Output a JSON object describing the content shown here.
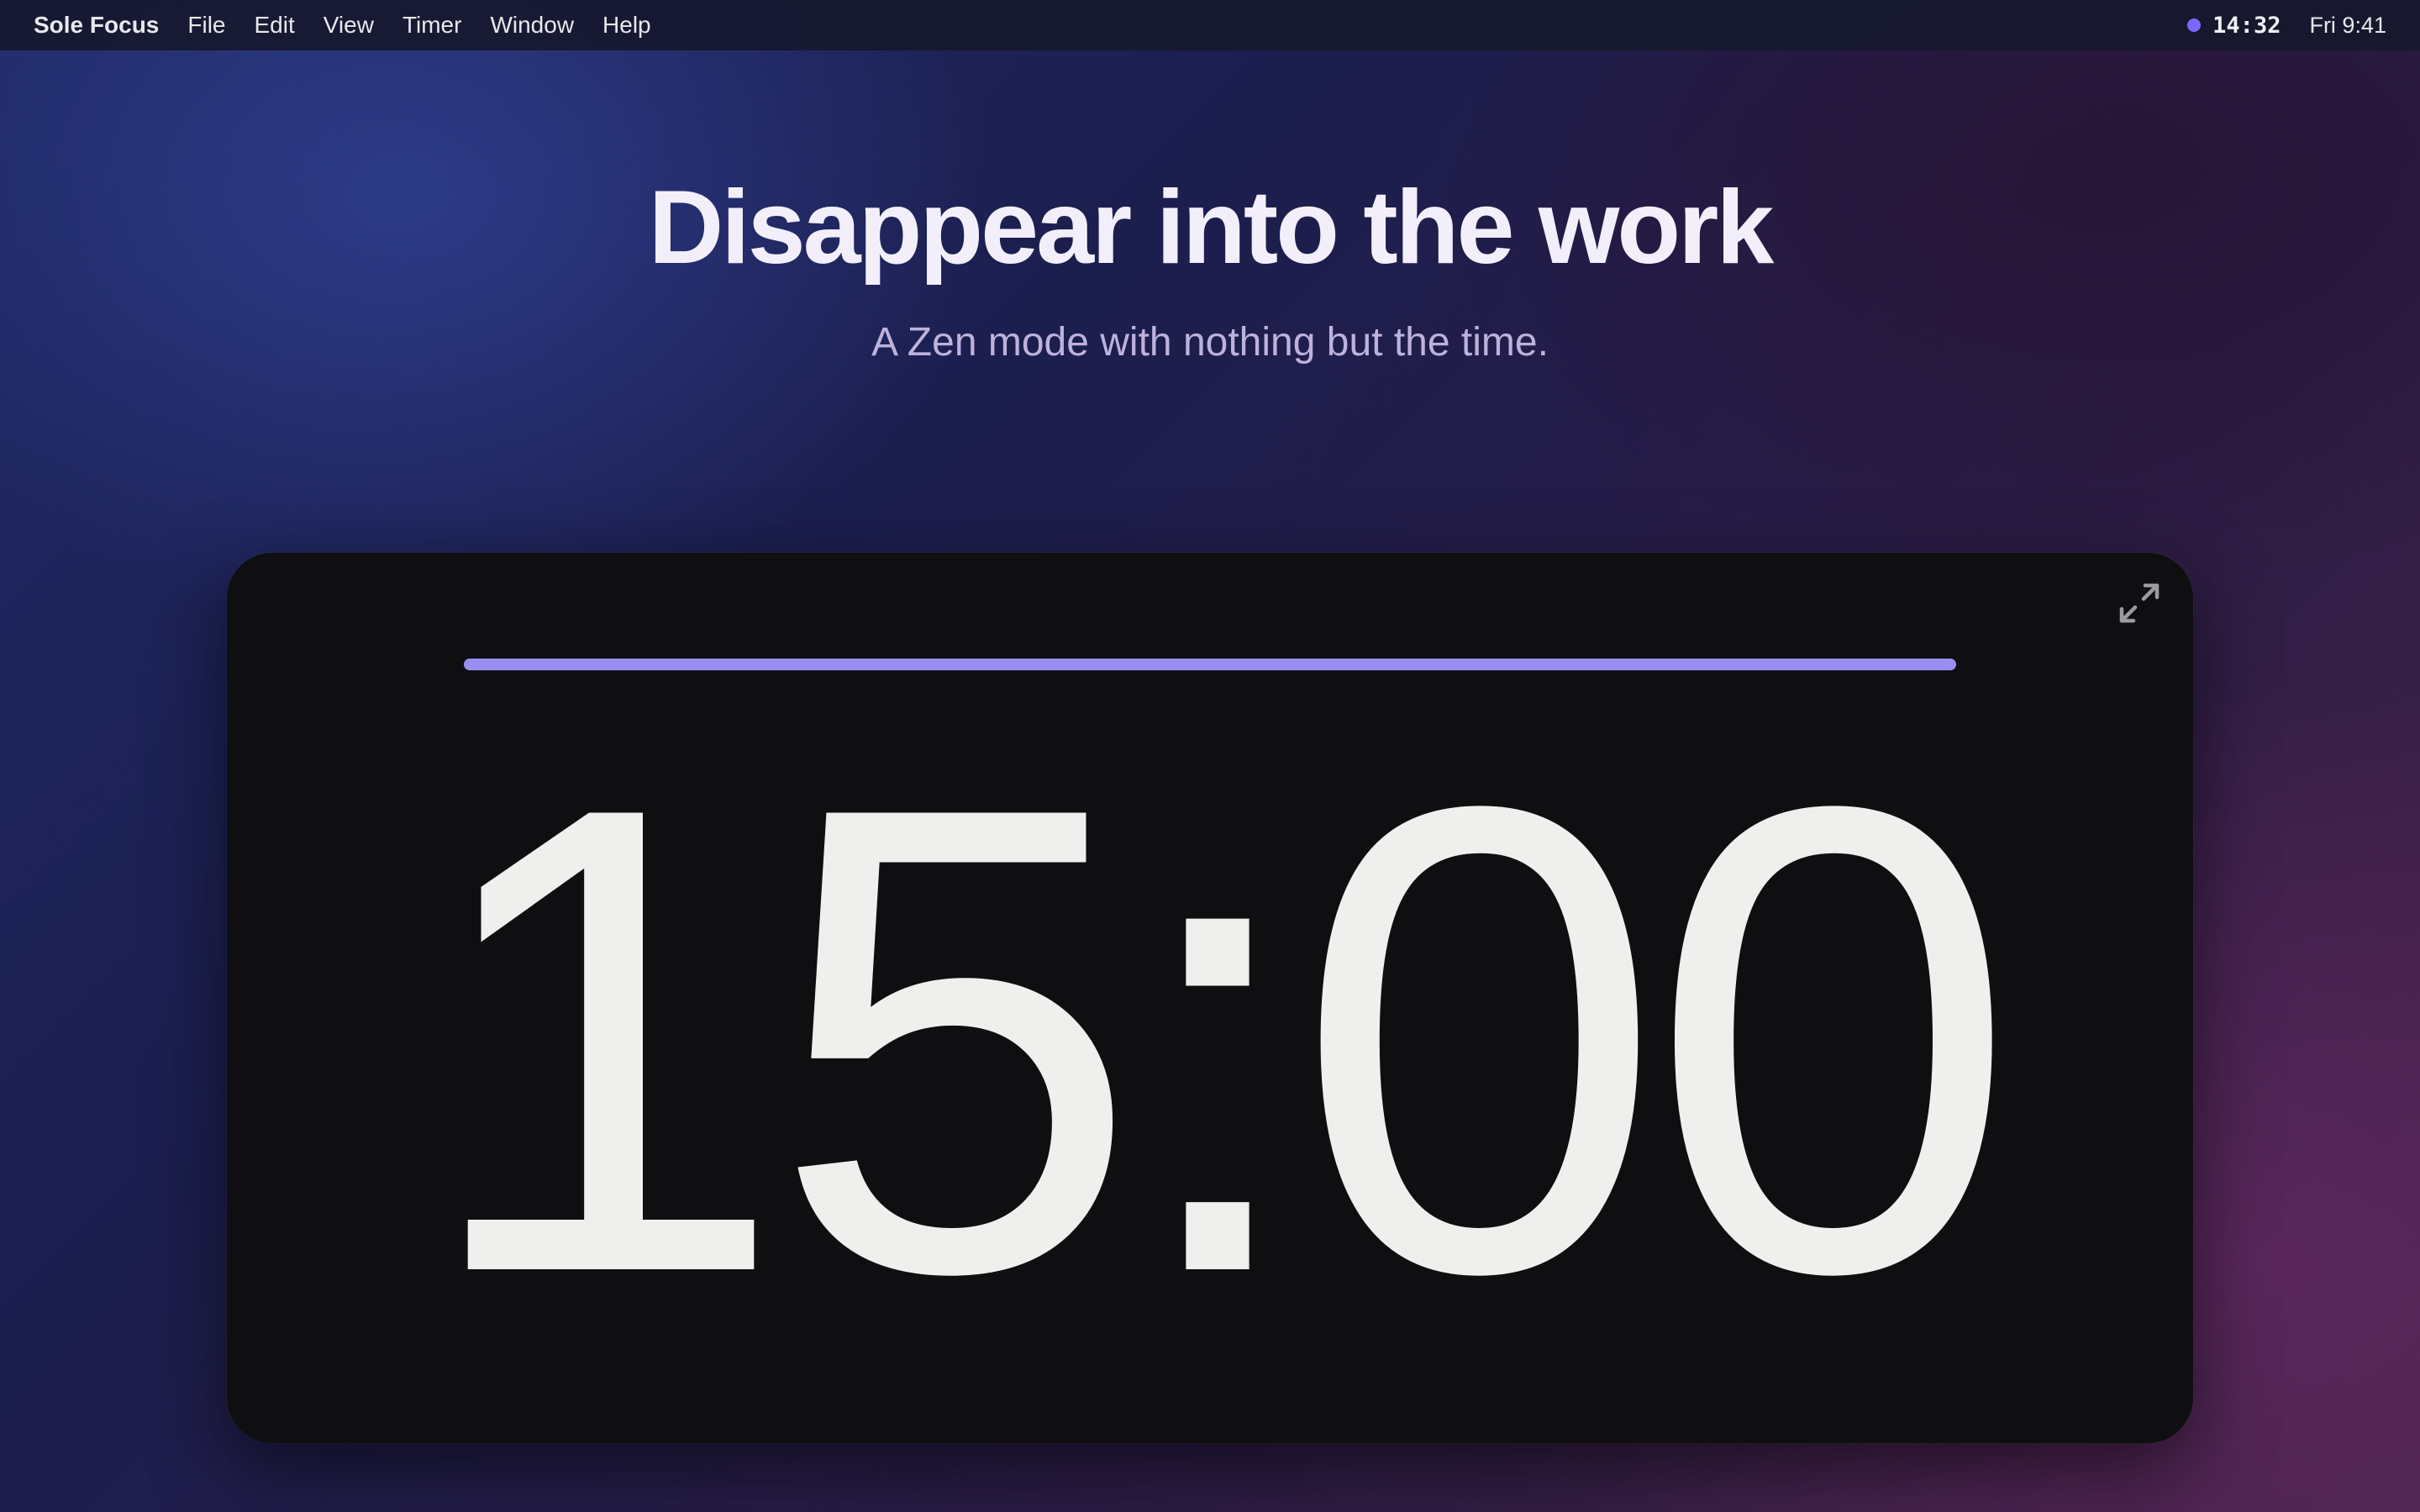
{
  "menubar": {
    "app_name": "Sole Focus",
    "items": [
      "File",
      "Edit",
      "View",
      "Timer",
      "Window",
      "Help"
    ],
    "status_timer": "14:32",
    "status_dot_color": "#7c66ff",
    "clock": "Fri 9:41"
  },
  "hero": {
    "title": "Disappear into the work",
    "subtitle": "A Zen mode with nothing but the time."
  },
  "timer": {
    "display": "15:00",
    "progress_fraction": 1.0,
    "progress_color": "#9a8ef0",
    "expand_icon": "expand-icon"
  }
}
